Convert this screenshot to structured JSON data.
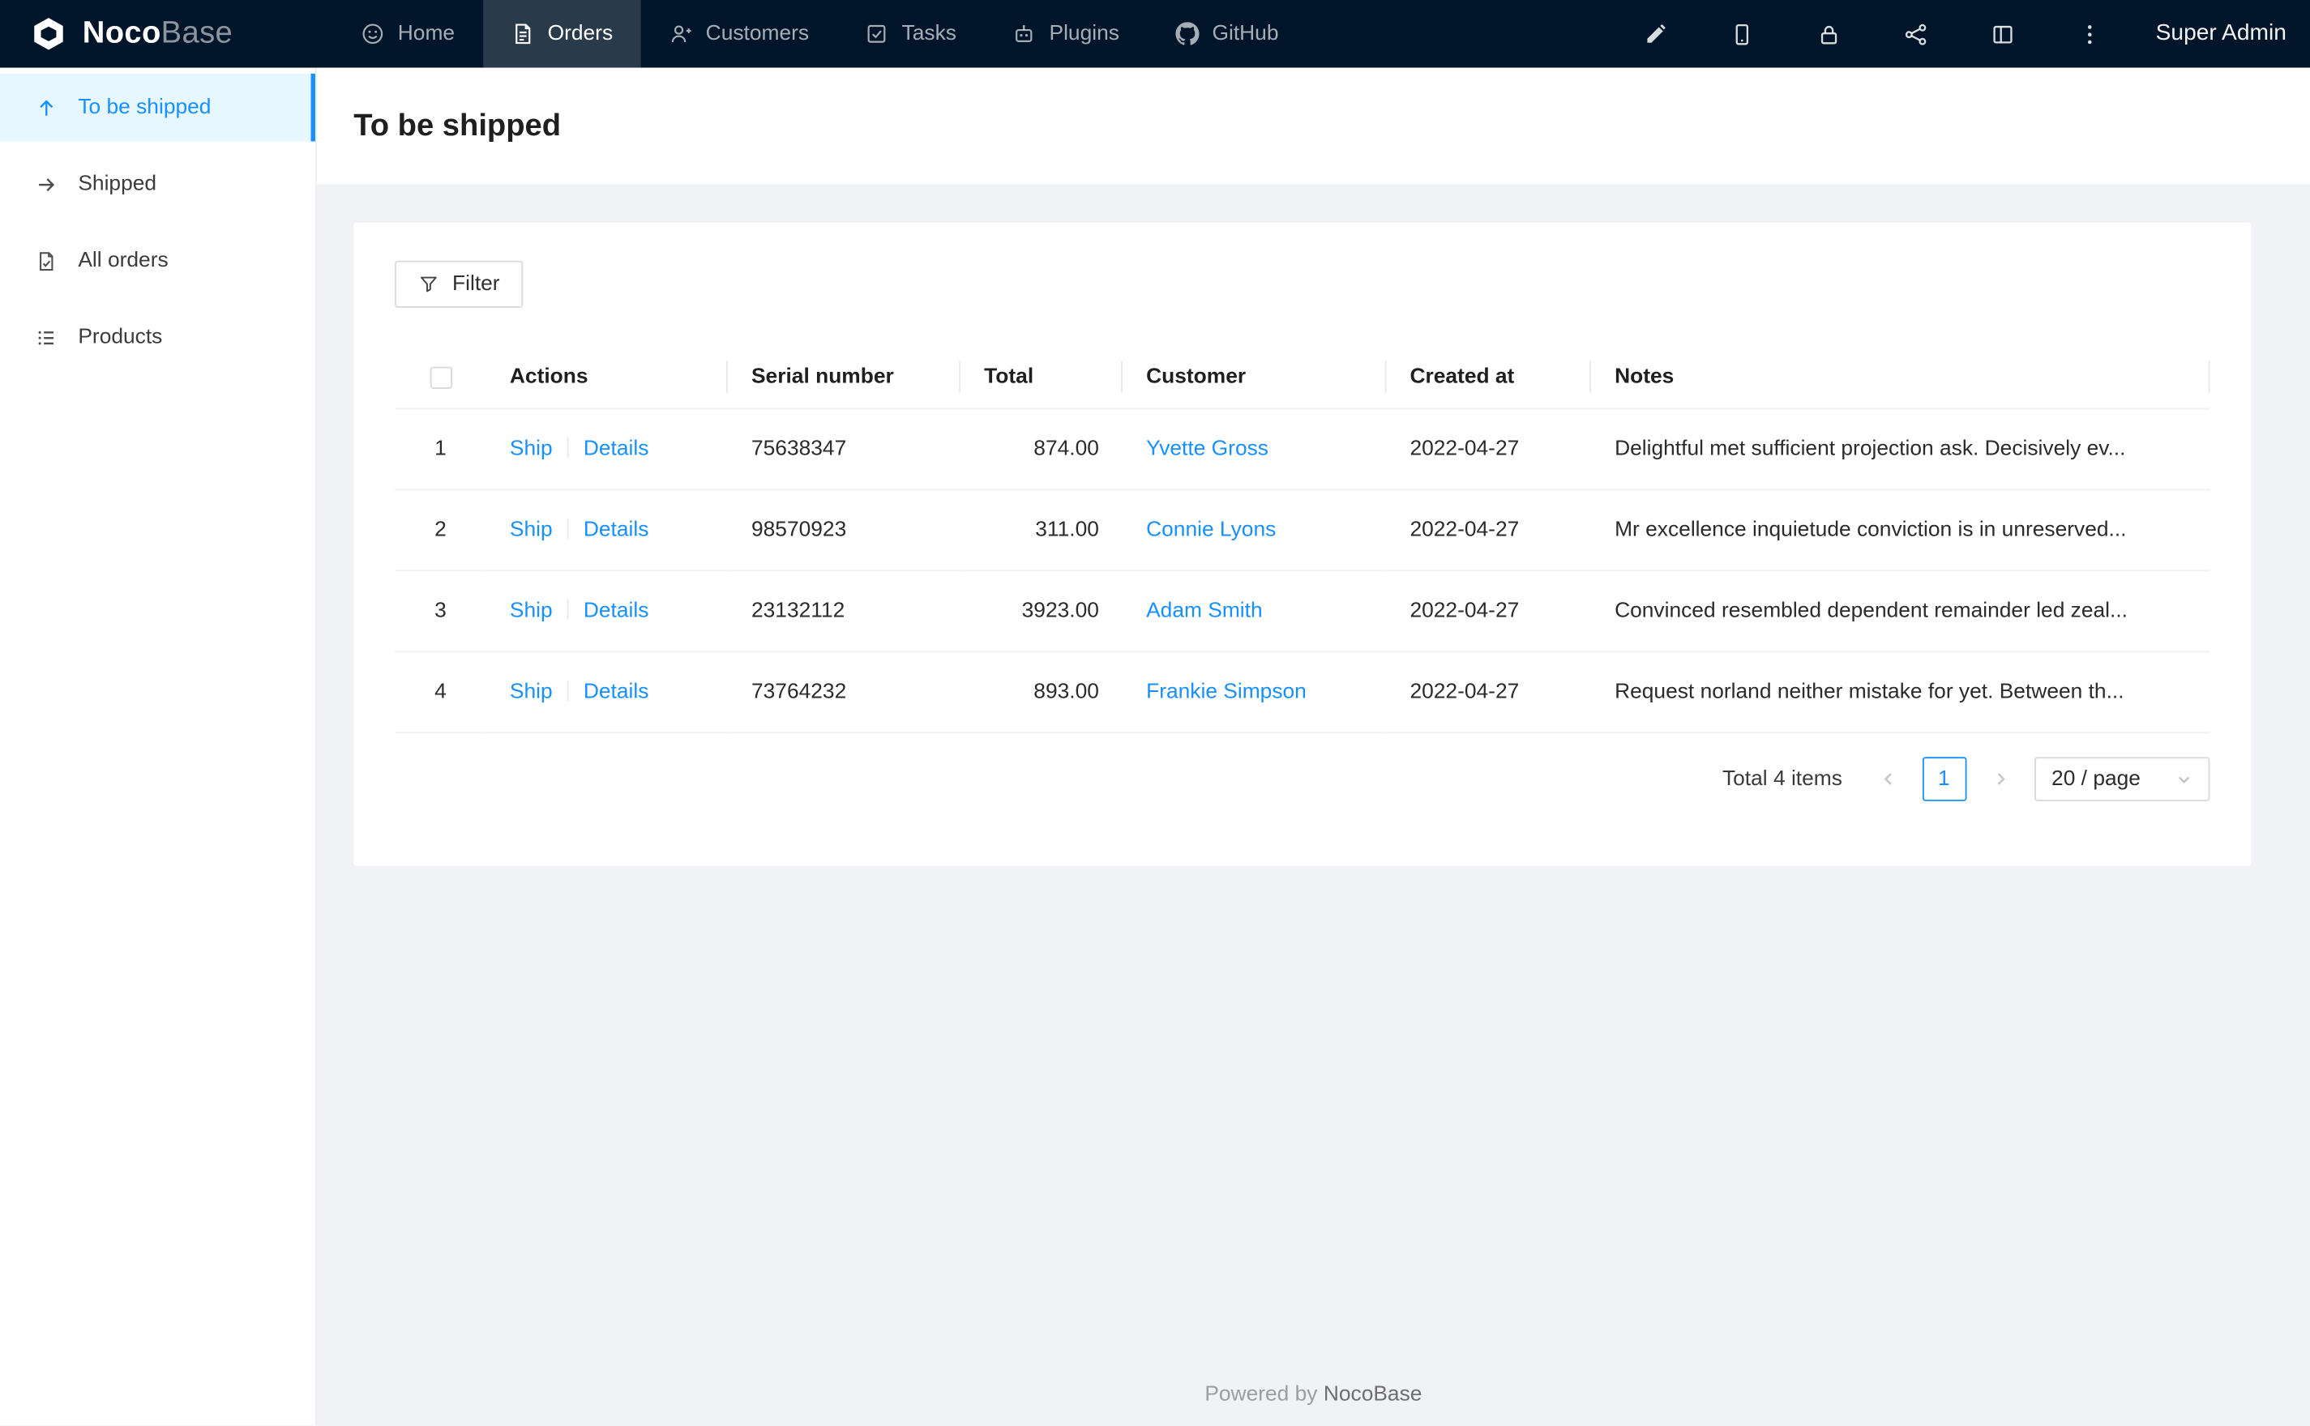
{
  "colors": {
    "accent": "#1890ff",
    "navbar_bg": "#001529",
    "sidebar_active_bg": "#e6f7ff",
    "page_bg": "#f0f2f5",
    "border": "#f0f0f0"
  },
  "navbar": {
    "brand": {
      "bold": "Noco",
      "light": "Base"
    },
    "items": [
      {
        "label": "Home"
      },
      {
        "label": "Orders",
        "active": true
      },
      {
        "label": "Customers"
      },
      {
        "label": "Tasks"
      },
      {
        "label": "Plugins"
      },
      {
        "label": "GitHub"
      }
    ],
    "user": "Super Admin"
  },
  "sidebar": {
    "items": [
      {
        "label": "To be shipped",
        "active": true
      },
      {
        "label": "Shipped"
      },
      {
        "label": "All orders"
      },
      {
        "label": "Products"
      }
    ]
  },
  "page": {
    "title": "To be shipped"
  },
  "toolbar": {
    "filter_label": "Filter"
  },
  "table": {
    "columns": [
      "Actions",
      "Serial number",
      "Total",
      "Customer",
      "Created at",
      "Notes"
    ],
    "rows": [
      {
        "index": "1",
        "actions": [
          "Ship",
          "Details"
        ],
        "serial": "75638347",
        "total": "874.00",
        "customer": "Yvette Gross",
        "created_at": "2022-04-27",
        "notes": "Delightful met sufficient projection ask. Decisively ev..."
      },
      {
        "index": "2",
        "actions": [
          "Ship",
          "Details"
        ],
        "serial": "98570923",
        "total": "311.00",
        "customer": "Connie Lyons",
        "created_at": "2022-04-27",
        "notes": "Mr excellence inquietude conviction is in unreserved..."
      },
      {
        "index": "3",
        "actions": [
          "Ship",
          "Details"
        ],
        "serial": "23132112",
        "total": "3923.00",
        "customer": "Adam Smith",
        "created_at": "2022-04-27",
        "notes": "Convinced resembled dependent remainder led zeal..."
      },
      {
        "index": "4",
        "actions": [
          "Ship",
          "Details"
        ],
        "serial": "73764232",
        "total": "893.00",
        "customer": "Frankie Simpson",
        "created_at": "2022-04-27",
        "notes": "Request norland neither mistake for yet. Between th..."
      }
    ]
  },
  "pagination": {
    "total_text": "Total 4 items",
    "current_page": "1",
    "page_size": "20 / page"
  },
  "footer": {
    "prefix": "Powered by ",
    "brand": "NocoBase"
  }
}
